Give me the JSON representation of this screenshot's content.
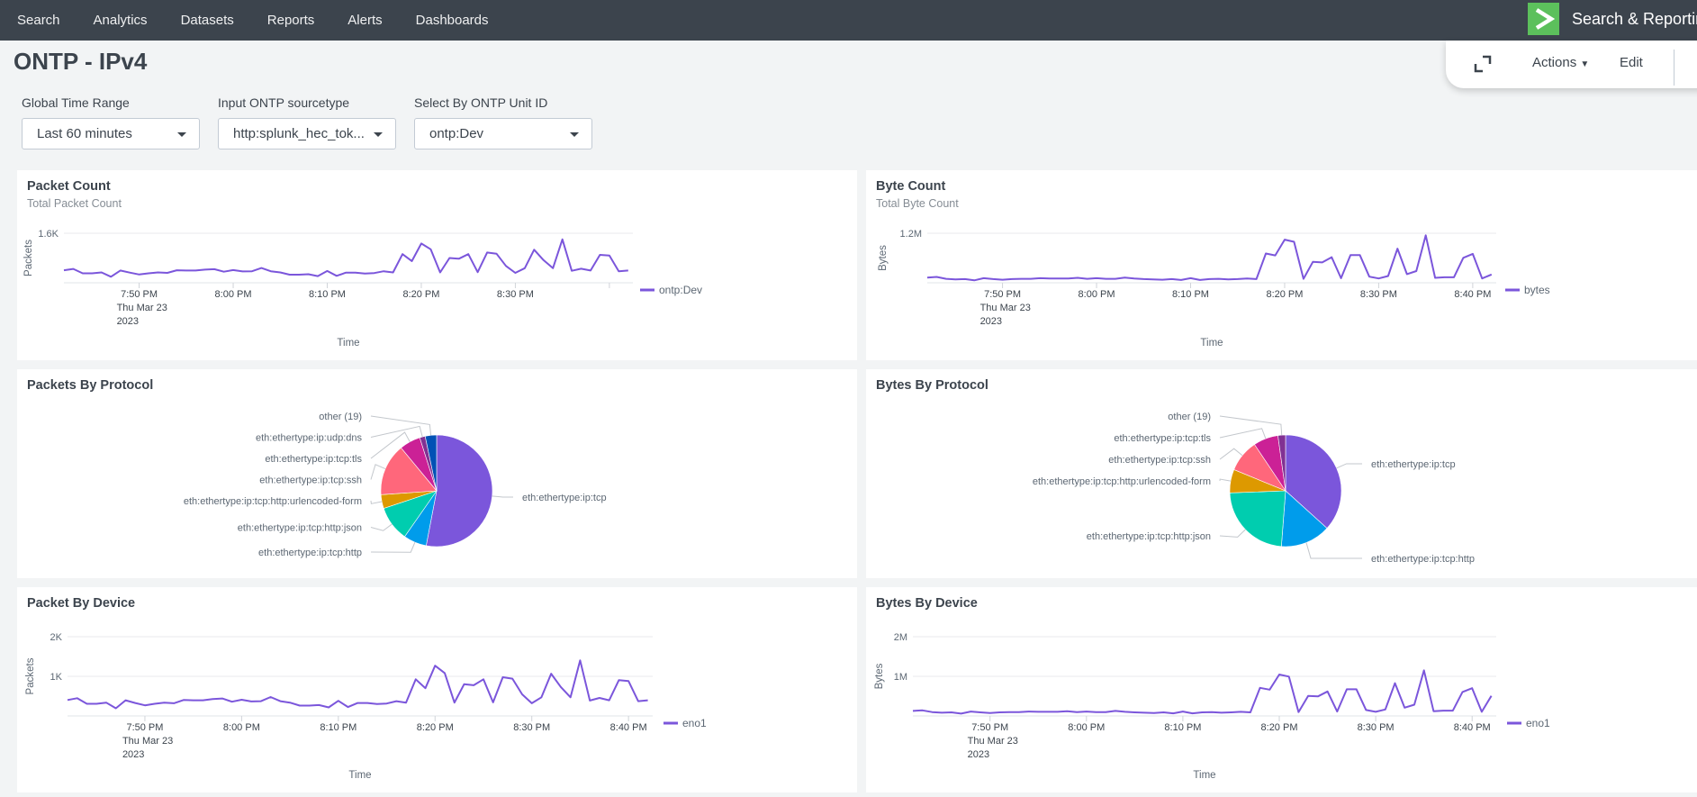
{
  "nav": {
    "items": [
      "Search",
      "Analytics",
      "Datasets",
      "Reports",
      "Alerts",
      "Dashboards"
    ],
    "app_name": "Search & Reporting",
    "app_logo": "chevron-right-icon"
  },
  "page": {
    "title": "ONTP - IPv4"
  },
  "actions": {
    "expand_icon": "expand-icon",
    "actions_label": "Actions",
    "edit_label": "Edit"
  },
  "inputs": [
    {
      "label": "Global Time Range",
      "value": "Last 60 minutes"
    },
    {
      "label": "Input ONTP sourcetype",
      "value": "http:splunk_hec_tok..."
    },
    {
      "label": "Select By ONTP Unit ID",
      "value": "ontp:Dev"
    }
  ],
  "colors": {
    "series": "#7b56db",
    "pie": [
      "#7b56db",
      "#009ceb",
      "#00cdaf",
      "#dd9900",
      "#ff677b",
      "#cb2196",
      "#813193",
      "#0051b5"
    ]
  },
  "panels": {
    "packet_count": {
      "title": "Packet Count",
      "subtitle": "Total Packet Count"
    },
    "byte_count": {
      "title": "Byte Count",
      "subtitle": "Total Byte Count"
    },
    "packets_protocol": {
      "title": "Packets By Protocol"
    },
    "bytes_protocol": {
      "title": "Bytes By Protocol"
    },
    "packet_device": {
      "title": "Packet By Device"
    },
    "bytes_device": {
      "title": "Bytes By Device"
    }
  },
  "chart_data": [
    {
      "id": "packet_count",
      "type": "line",
      "title": "Packet Count",
      "subtitle": "Total Packet Count",
      "xlabel": "Time",
      "ylabel": "Packets",
      "x_start": "7:42 PM",
      "x_step_minutes": 1,
      "x_ticks": [
        "7:50 PM",
        "8:00 PM",
        "8:10 PM",
        "8:20 PM",
        "8:30 PM",
        ""
      ],
      "x_tick_sub": [
        "Thu Mar 23",
        "2023"
      ],
      "y_ticks": [
        "1.6K"
      ],
      "ylim": [
        0,
        1600
      ],
      "legend": "right",
      "series": [
        {
          "name": "ontp:Dev",
          "values": [
            403,
            448,
            306,
            306,
            336,
            194,
            396,
            328,
            269,
            306,
            336,
            321,
            403,
            396,
            396,
            425,
            440,
            358,
            410,
            366,
            373,
            478,
            373,
            336,
            261,
            261,
            276,
            216,
            381,
            224,
            328,
            328,
            299,
            313,
            373,
            336,
            925,
            701,
            1269,
            1082,
            336,
            799,
            776,
            925,
            343,
            978,
            940,
            545,
            321,
            470,
            1067,
            731,
            470,
            1403,
            388,
            455,
            396,
            903,
            881,
            373,
            396
          ]
        }
      ]
    },
    {
      "id": "byte_count",
      "type": "line",
      "title": "Byte Count",
      "subtitle": "Total Byte Count",
      "xlabel": "Time",
      "ylabel": "Bytes",
      "x_start": "7:42 PM",
      "x_step_minutes": 1,
      "x_ticks": [
        "7:50 PM",
        "8:00 PM",
        "8:10 PM",
        "8:20 PM",
        "8:30 PM",
        "8:40 PM"
      ],
      "x_tick_sub": [
        "Thu Mar 23",
        "2023"
      ],
      "y_ticks": [
        "1.2M"
      ],
      "ylim": [
        0,
        1200000
      ],
      "legend": "right",
      "series": [
        {
          "name": "bytes",
          "values": [
            127000,
            142000,
            97000,
            82000,
            90000,
            60000,
            112000,
            90000,
            75000,
            90000,
            97000,
            97000,
            112000,
            105000,
            105000,
            105000,
            120000,
            97000,
            112000,
            97000,
            97000,
            127000,
            105000,
            90000,
            82000,
            75000,
            90000,
            67000,
            112000,
            67000,
            90000,
            97000,
            82000,
            90000,
            105000,
            90000,
            709000,
            664000,
            1045000,
            993000,
            97000,
            507000,
            493000,
            619000,
            112000,
            672000,
            672000,
            149000,
            105000,
            164000,
            828000,
            209000,
            284000,
            1149000,
            120000,
            134000,
            134000,
            604000,
            701000,
            105000,
            200000
          ]
        }
      ]
    },
    {
      "id": "packets_protocol",
      "type": "pie",
      "title": "Packets By Protocol",
      "slices": [
        {
          "label": "eth:ethertype:ip:tcp",
          "value": 53.0
        },
        {
          "label": "eth:ethertype:ip:tcp:http",
          "value": 6.7
        },
        {
          "label": "eth:ethertype:ip:tcp:http:json",
          "value": 10.2
        },
        {
          "label": "eth:ethertype:ip:tcp:http:urlencoded-form",
          "value": 4.0
        },
        {
          "label": "eth:ethertype:ip:tcp:ssh",
          "value": 15.1
        },
        {
          "label": "eth:ethertype:ip:tcp:tls",
          "value": 6.1
        },
        {
          "label": "eth:ethertype:ip:udp:dns",
          "value": 1.6
        },
        {
          "label": "other (19)",
          "value": 3.3
        }
      ]
    },
    {
      "id": "bytes_protocol",
      "type": "pie",
      "title": "Bytes By Protocol",
      "slices": [
        {
          "label": "eth:ethertype:ip:tcp",
          "value": 36.7
        },
        {
          "label": "eth:ethertype:ip:tcp:http",
          "value": 14.5
        },
        {
          "label": "eth:ethertype:ip:tcp:http:json",
          "value": 23.2
        },
        {
          "label": "eth:ethertype:ip:tcp:http:urlencoded-form",
          "value": 6.8
        },
        {
          "label": "eth:ethertype:ip:tcp:ssh",
          "value": 9.4
        },
        {
          "label": "eth:ethertype:ip:tcp:tls",
          "value": 7.2
        },
        {
          "label": "other (19)",
          "value": 2.2
        }
      ]
    },
    {
      "id": "packet_device",
      "type": "line",
      "title": "Packet By Device",
      "xlabel": "Time",
      "ylabel": "Packets",
      "x_start": "7:42 PM",
      "x_step_minutes": 1,
      "x_ticks": [
        "7:50 PM",
        "8:00 PM",
        "8:10 PM",
        "8:20 PM",
        "8:30 PM",
        "8:40 PM"
      ],
      "x_tick_sub": [
        "Thu Mar 23",
        "2023"
      ],
      "y_ticks": [
        "1K",
        "2K"
      ],
      "ylim": [
        0,
        2000
      ],
      "legend": "right",
      "series": [
        {
          "name": "eno1",
          "values": [
            403,
            448,
            306,
            306,
            336,
            194,
            396,
            328,
            269,
            306,
            336,
            321,
            403,
            396,
            396,
            425,
            440,
            358,
            410,
            366,
            373,
            478,
            373,
            336,
            261,
            261,
            276,
            216,
            381,
            224,
            328,
            328,
            299,
            313,
            373,
            336,
            925,
            701,
            1269,
            1082,
            336,
            799,
            776,
            925,
            343,
            978,
            940,
            545,
            321,
            470,
            1067,
            731,
            470,
            1403,
            388,
            455,
            396,
            903,
            881,
            373,
            396
          ]
        }
      ]
    },
    {
      "id": "bytes_device",
      "type": "line",
      "title": "Bytes By Device",
      "xlabel": "Time",
      "ylabel": "Bytes",
      "x_start": "7:42 PM",
      "x_step_minutes": 1,
      "x_ticks": [
        "7:50 PM",
        "8:00 PM",
        "8:10 PM",
        "8:20 PM",
        "8:30 PM",
        "8:40 PM"
      ],
      "x_tick_sub": [
        "Thu Mar 23",
        "2023"
      ],
      "y_ticks": [
        "1M",
        "2M"
      ],
      "ylim": [
        0,
        2000000
      ],
      "legend": "right",
      "series": [
        {
          "name": "eno1",
          "values": [
            127000,
            142000,
            97000,
            82000,
            90000,
            60000,
            112000,
            90000,
            75000,
            90000,
            97000,
            97000,
            112000,
            105000,
            105000,
            105000,
            120000,
            97000,
            112000,
            97000,
            97000,
            127000,
            105000,
            90000,
            82000,
            75000,
            90000,
            67000,
            112000,
            67000,
            90000,
            97000,
            82000,
            90000,
            105000,
            90000,
            709000,
            664000,
            1045000,
            993000,
            97000,
            507000,
            493000,
            619000,
            112000,
            672000,
            672000,
            149000,
            105000,
            164000,
            828000,
            209000,
            284000,
            1149000,
            120000,
            134000,
            134000,
            604000,
            701000,
            105000,
            507000
          ]
        }
      ]
    }
  ]
}
